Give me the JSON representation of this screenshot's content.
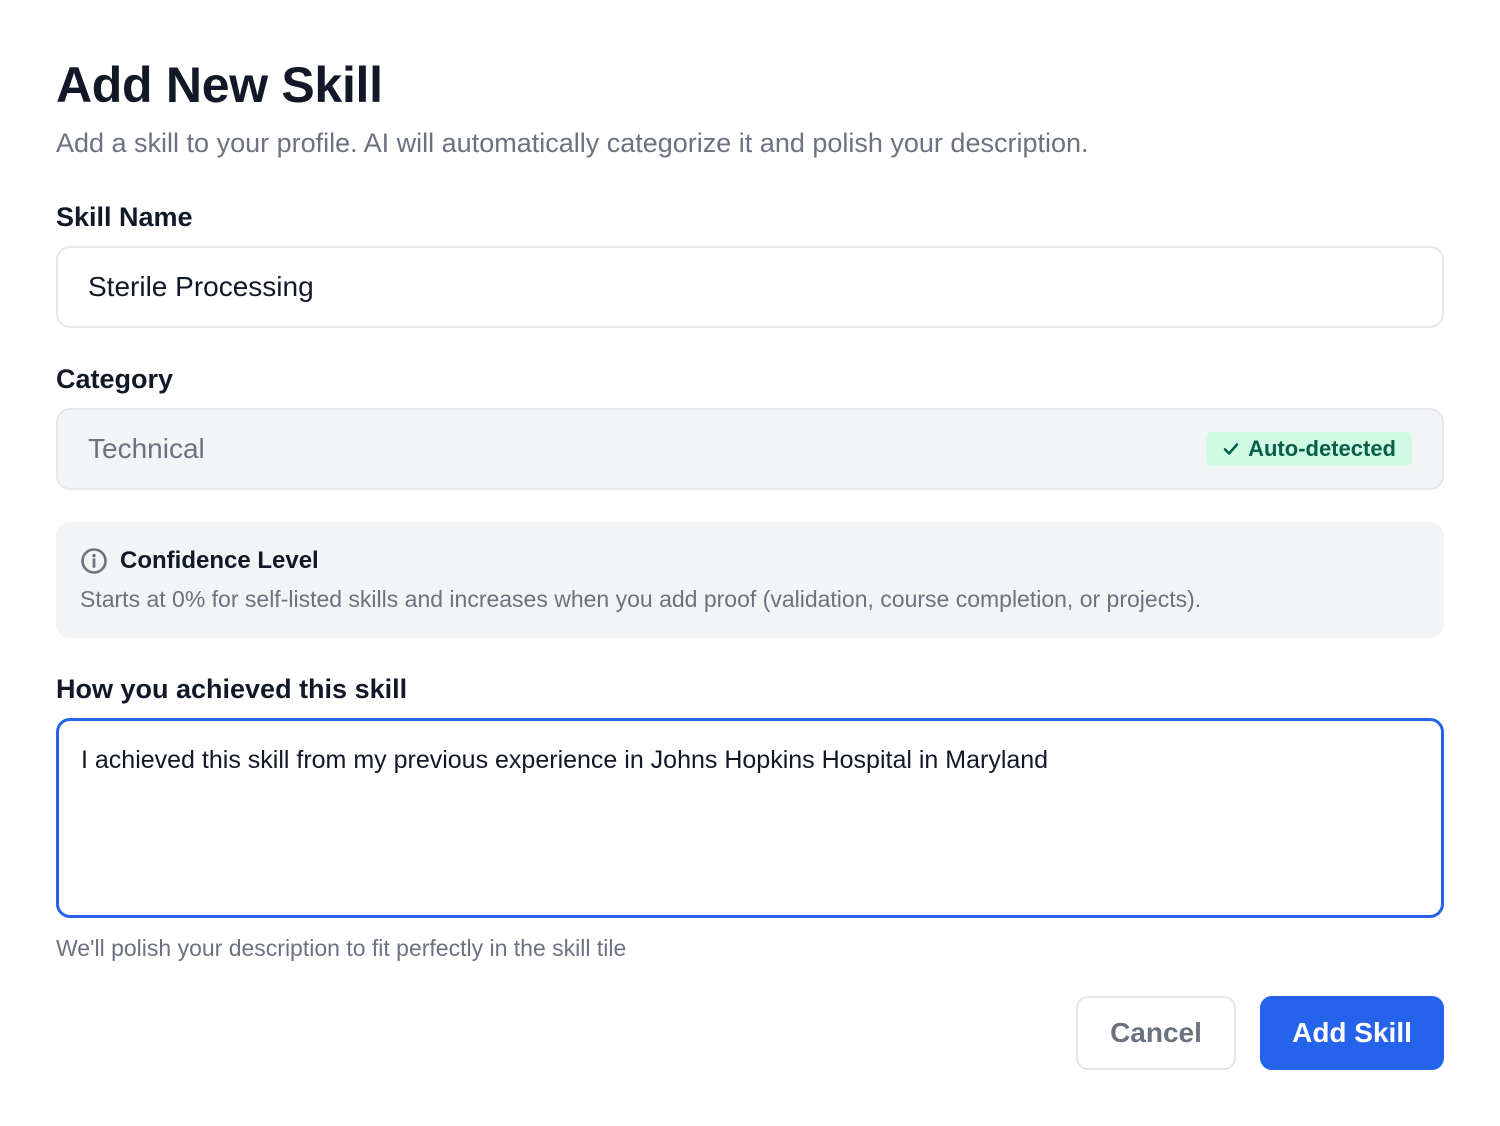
{
  "header": {
    "title": "Add New Skill",
    "subtitle": "Add a skill to your profile. AI will automatically categorize it and polish your description."
  },
  "skill_name": {
    "label": "Skill Name",
    "value": "Sterile Processing"
  },
  "category": {
    "label": "Category",
    "value": "Technical",
    "badge": "Auto-detected",
    "badge_icon": "check-icon"
  },
  "confidence": {
    "icon": "info-icon",
    "title": "Confidence Level",
    "text": "Starts at 0% for self-listed skills and increases when you add proof (validation, course completion, or projects)."
  },
  "achievement": {
    "label": "How you achieved this skill",
    "value": "I achieved this skill from my previous experience in Johns Hopkins Hospital in Maryland",
    "helper": "We'll polish your description to fit perfectly in the skill tile"
  },
  "actions": {
    "cancel_label": "Cancel",
    "add_label": "Add Skill"
  },
  "colors": {
    "primary": "#2563eb",
    "badge_bg": "#d1fae5",
    "badge_text": "#065f46",
    "muted": "#6b7280"
  }
}
